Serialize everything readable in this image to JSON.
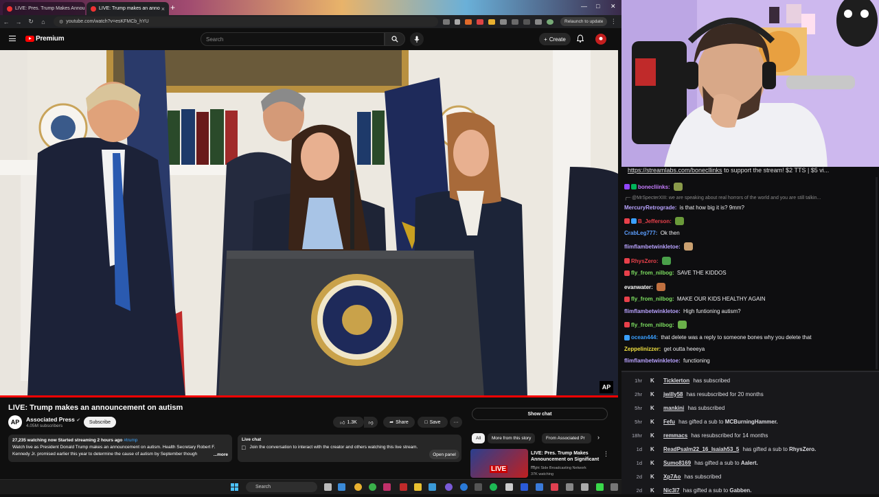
{
  "browser": {
    "tabs": [
      {
        "label": "LIVE: Pres. Trump Makes Annou",
        "close": "×"
      },
      {
        "label": "LIVE: Trump makes an anno",
        "close": "×"
      }
    ],
    "new_tab": "+",
    "url": "youtube.com/watch?v=esKFMCb_hYU",
    "relaunch_label": "Relaunch to update"
  },
  "youtube": {
    "brand": "Premium",
    "search_placeholder": "Search",
    "create_label": "Create",
    "video": {
      "title": "LIVE: Trump makes an announcement on autism",
      "badge": "AP",
      "progress": 1.0
    },
    "channel": {
      "avatar_text": "AP",
      "name": "Associated Press",
      "subscribers": "4.05M subscribers",
      "subscribe_label": "Subscribe"
    },
    "actions": {
      "likes": "1.3K",
      "share_label": "Share",
      "save_label": "Save",
      "more": "···"
    },
    "description": {
      "meta": "27,235 watching now  Started streaming 2 hours ago",
      "hashtag": "#trump",
      "text": "Watch live as President Donald Trump makes an announcement on autism. Health Secretary Robert F. Kennedy Jr. promised earlier this year to determine the cause of autism by September though",
      "more": "...more"
    },
    "live_chat": {
      "heading": "Live chat",
      "text": "Join the conversation to interact with the creator and others watching this live stream.",
      "open_panel": "Open panel"
    },
    "show_chat_label": "Show chat",
    "chips": [
      "All",
      "More from this story",
      "From Associated Pr"
    ],
    "recommended": {
      "title": "LIVE: Pres. Trump Makes Announcement on Significant ...",
      "channel": "Right Side Broadcasting Network",
      "watching": "37K watching",
      "thumb_label": "LIVE"
    }
  },
  "taskbar": {
    "search_placeholder": "Search"
  },
  "stream": {
    "banner_link": "https://streamlabs.com/bonecllinks",
    "banner_text": " to support the stream! $2 TTS | $5 vi..."
  },
  "chat": [
    {
      "user": "bonecliinks:",
      "color": "#c77dff",
      "text": "",
      "emote": "#8a9a4a",
      "badges": [
        "#9146ff",
        "#00b35a"
      ]
    },
    {
      "user": "",
      "color": "#8a8a8a",
      "text": "@MrSpecterXIII: we are speaking about real horrors of the world and you are still talkin...",
      "reply": true
    },
    {
      "user": "MercuryRetrograde:",
      "color": "#b9a3ff",
      "text": " is that how big it is? 9mm?"
    },
    {
      "user": "B_Jefferson:",
      "color": "#e8404a",
      "text": "",
      "emote": "#6a9a3a",
      "badges": [
        "#e8404a",
        "#3aa0ff"
      ]
    },
    {
      "user": "CrabLeg777:",
      "color": "#5c9eff",
      "text": " Ok then"
    },
    {
      "user": "flimflambetwinkletoe:",
      "color": "#b9a3ff",
      "text": "",
      "emote": "#caa070"
    },
    {
      "user": "RhysZero:",
      "color": "#e8404a",
      "text": "",
      "emote": "#4aa04a",
      "badges": [
        "#e8404a"
      ]
    },
    {
      "user": "fly_from_nilbog:",
      "color": "#7dde60",
      "text": " SAVE THE KIDDOS",
      "badges": [
        "#e8404a"
      ]
    },
    {
      "user": "evanwater:",
      "color": "#ffffff",
      "text": "",
      "emote": "#c07040"
    },
    {
      "user": "fly_from_nilbog:",
      "color": "#7dde60",
      "text": " MAKE OUR KIDS HEALTHY AGAIN",
      "badges": [
        "#e8404a"
      ]
    },
    {
      "user": "flimflambetwinkletoe:",
      "color": "#b9a3ff",
      "text": " High funtioning autism?"
    },
    {
      "user": "fly_from_nilbog:",
      "color": "#7dde60",
      "text": "",
      "emote": "#6ab04a",
      "badges": [
        "#e8404a"
      ]
    },
    {
      "user": "ocean444:",
      "color": "#3aa0ff",
      "text": " that delete was a reply to someone bones why you delete that",
      "badges": [
        "#3aa0ff"
      ]
    },
    {
      "user": "Zeppelinizzer:",
      "color": "#f0e040",
      "text": " get outta heeeya"
    },
    {
      "user": "flimflambetwinkletoe:",
      "color": "#b9a3ff",
      "text": " functioning"
    }
  ],
  "events": [
    {
      "time": "1hr",
      "name": "Ticklerton",
      "text": " has subscribed"
    },
    {
      "time": "2hr",
      "name": "jwilly58",
      "text": " has resubscribed for 20 months"
    },
    {
      "time": "5hr",
      "name": "mankini",
      "text": " has subscribed"
    },
    {
      "time": "5hr",
      "name": "Fefu",
      "text": " has gifted a sub to ",
      "target": "MCBurningHammer."
    },
    {
      "time": "18hr",
      "name": "remmacs",
      "text": " has resubscribed for 14 months"
    },
    {
      "time": "1d",
      "name": "ReadPsalm22_16_Isaiah53_5",
      "text": " has gifted a sub to ",
      "target": "RhysZero."
    },
    {
      "time": "1d",
      "name": "Sumo8169",
      "text": " has gifted a sub to ",
      "target": "Aalert."
    },
    {
      "time": "2d",
      "name": "Xp7Ao",
      "text": " has subscribed"
    },
    {
      "time": "2d",
      "name": "Nic3l7",
      "text": " has gifted a sub to ",
      "target": "Gabben."
    }
  ],
  "colors": {
    "youtube_red": "#ff0000",
    "chat_bg": "#0e0e10",
    "events_bg": "#18181b"
  }
}
